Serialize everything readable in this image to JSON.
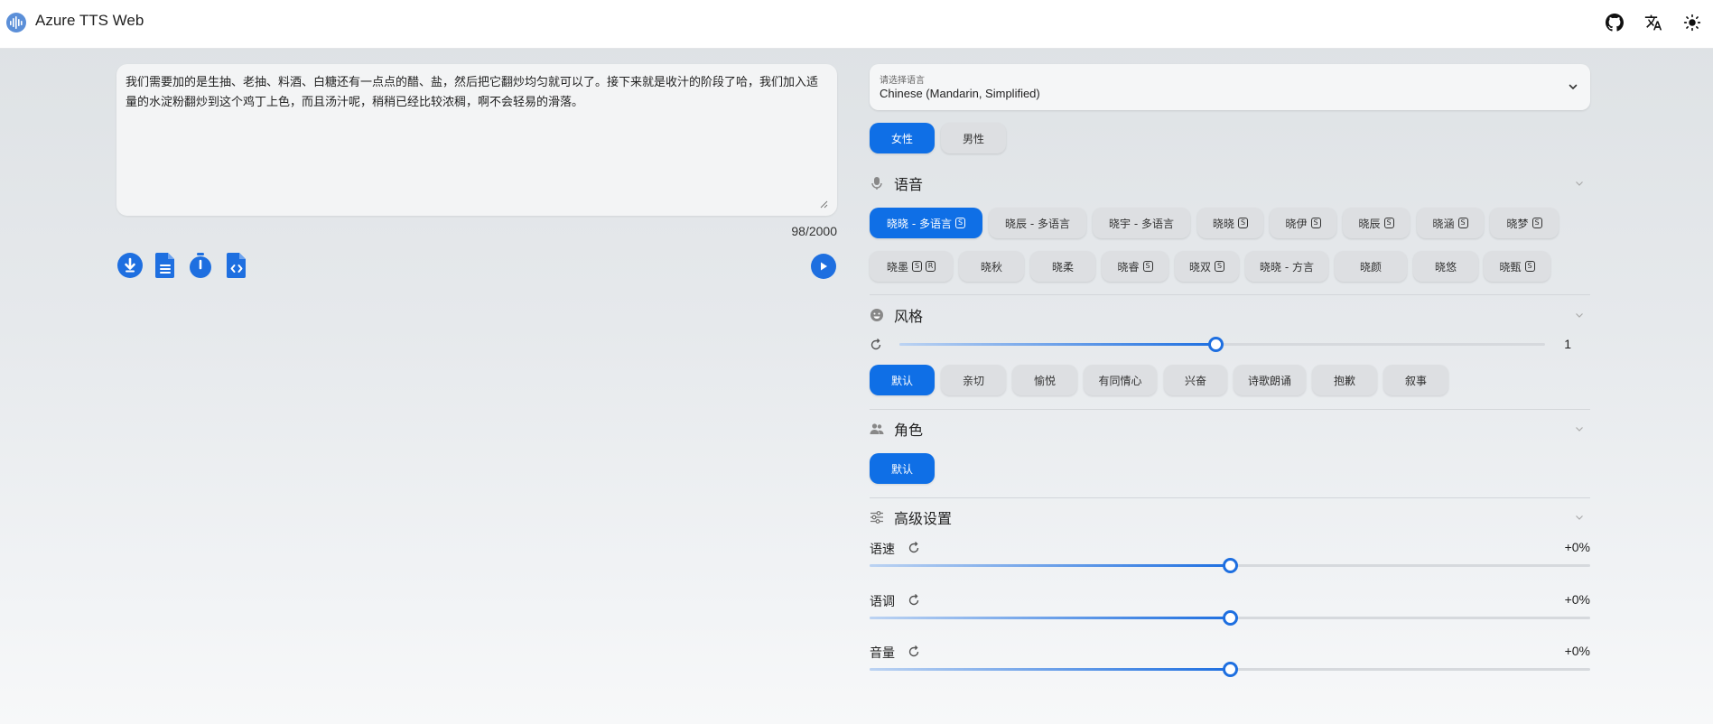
{
  "app": {
    "title": "Azure TTS Web"
  },
  "colors": {
    "accent": "#0f6fe6",
    "chip_bg": "#dddfe2"
  },
  "topbar_icons": [
    "github-icon",
    "translate-icon",
    "theme-sun-icon"
  ],
  "editor": {
    "text": "我们需要加的是生抽、老抽、料酒、白糖还有一点点的醋、盐，然后把它翻炒均匀就可以了。接下来就是收汁的阶段了哈，我们加入适量的水淀粉翻炒到这个鸡丁上色，而且汤汁呢，稍稍已经比较浓稠，啊不会轻易的滑落。",
    "char_count": "98/2000"
  },
  "toolbar_icons": [
    "download-icon",
    "document-icon",
    "timer-icon",
    "code-file-icon"
  ],
  "language_select": {
    "label": "请选择语言",
    "value": "Chinese (Mandarin, Simplified)"
  },
  "gender": {
    "female": "女性",
    "male": "男性",
    "selected": "female"
  },
  "voice_section": {
    "title": "语音",
    "voices": [
      {
        "label": "晓晓 - 多语言",
        "badges": [
          "S"
        ],
        "active": true
      },
      {
        "label": "晓辰 - 多语言",
        "badges": [],
        "active": false
      },
      {
        "label": "晓宇 - 多语言",
        "badges": [],
        "active": false
      },
      {
        "label": "晓晓",
        "badges": [
          "S"
        ],
        "active": false
      },
      {
        "label": "晓伊",
        "badges": [
          "S"
        ],
        "active": false
      },
      {
        "label": "晓辰",
        "badges": [
          "S"
        ],
        "active": false
      },
      {
        "label": "晓涵",
        "badges": [
          "S"
        ],
        "active": false
      },
      {
        "label": "晓梦",
        "badges": [
          "S"
        ],
        "active": false
      },
      {
        "label": "晓墨",
        "badges": [
          "S",
          "R"
        ],
        "active": false
      },
      {
        "label": "晓秋",
        "badges": [],
        "active": false
      },
      {
        "label": "晓柔",
        "badges": [],
        "active": false
      },
      {
        "label": "晓睿",
        "badges": [
          "S"
        ],
        "active": false
      },
      {
        "label": "晓双",
        "badges": [
          "S"
        ],
        "active": false
      },
      {
        "label": "晓晓 - 方言",
        "badges": [],
        "active": false
      },
      {
        "label": "晓颜",
        "badges": [],
        "active": false
      },
      {
        "label": "晓悠",
        "badges": [],
        "active": false
      },
      {
        "label": "晓甄",
        "badges": [
          "S"
        ],
        "active": false
      }
    ]
  },
  "style_section": {
    "title": "风格",
    "degree": 1,
    "degree_label": "1",
    "degree_fraction": 0.49,
    "styles": [
      "默认",
      "亲切",
      "愉悦",
      "有同情心",
      "兴奋",
      "诗歌朗诵",
      "抱歉",
      "叙事"
    ],
    "selected": "默认"
  },
  "role_section": {
    "title": "角色",
    "roles": [
      "默认"
    ],
    "selected": "默认"
  },
  "advanced_section": {
    "title": "高级设置",
    "sliders": [
      {
        "label": "语速",
        "value": "+0%",
        "fraction": 0.5
      },
      {
        "label": "语调",
        "value": "+0%",
        "fraction": 0.5
      },
      {
        "label": "音量",
        "value": "+0%",
        "fraction": 0.5
      }
    ]
  }
}
